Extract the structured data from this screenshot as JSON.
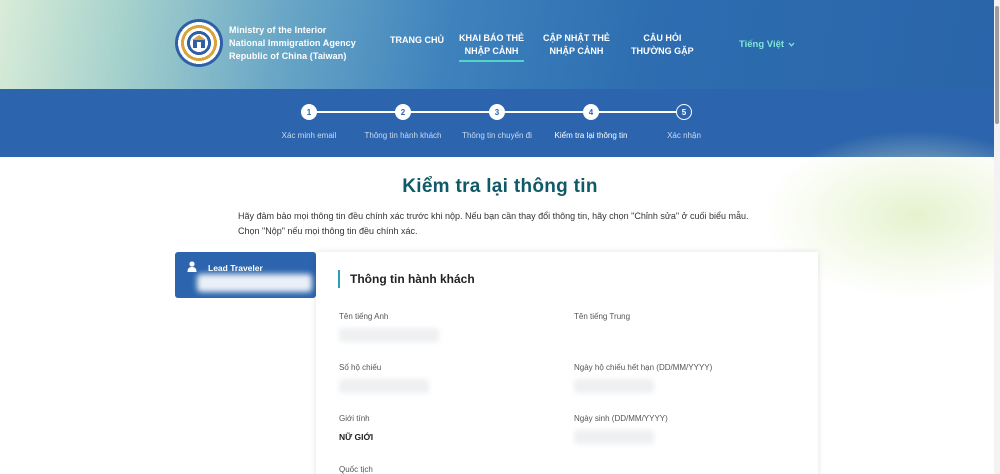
{
  "header": {
    "agency_lines": [
      "Ministry of the Interior",
      "National Immigration Agency",
      "Republic of China (Taiwan)"
    ],
    "nav": [
      {
        "line1": "TRANG CHỦ",
        "line2": ""
      },
      {
        "line1": "KHAI BÁO THẺ",
        "line2": "NHẬP CẢNH"
      },
      {
        "line1": "CẬP NHẬT THẺ",
        "line2": "NHẬP CẢNH"
      },
      {
        "line1": "CÂU HỎI",
        "line2": "THƯỜNG GẶP"
      }
    ],
    "language": "Tiếng Việt"
  },
  "stepper": {
    "current_step": 4,
    "steps": [
      {
        "number": "1",
        "label": "Xác minh email"
      },
      {
        "number": "2",
        "label": "Thông tin hành khách"
      },
      {
        "number": "3",
        "label": "Thông tin chuyến đi"
      },
      {
        "number": "4",
        "label": "Kiểm tra lại thông tin"
      },
      {
        "number": "5",
        "label": "Xác nhận"
      }
    ]
  },
  "main": {
    "title": "Kiểm tra lại thông tin",
    "description": "Hãy đảm bảo mọi thông tin đều chính xác trước khi nộp. Nếu bạn cần thay đổi thông tin, hãy chọn \"Chỉnh sửa\" ở cuối biểu mẫu. Chọn \"Nộp\" nếu mọi thông tin đều chính xác."
  },
  "sidebar": {
    "traveler_label": "Lead Traveler"
  },
  "panel": {
    "section_title": "Thông tin hành khách",
    "fields": {
      "english_name": {
        "label": "Tên tiếng Anh"
      },
      "chinese_name": {
        "label": "Tên tiếng Trung"
      },
      "passport_no": {
        "label": "Số hộ chiếu"
      },
      "passport_expiry": {
        "label": "Ngày hộ chiếu hết hạn (DD/MM/YYYY)"
      },
      "gender": {
        "label": "Giới tính",
        "value": "NỮ GIỚI"
      },
      "birth_date": {
        "label": "Ngày sinh (DD/MM/YYYY)"
      },
      "nationality": {
        "label": "Quốc tịch"
      }
    }
  },
  "colors": {
    "primary_blue": "#2c65ad",
    "title_teal": "#0f5a66",
    "accent_teal": "#4fd6c8"
  }
}
